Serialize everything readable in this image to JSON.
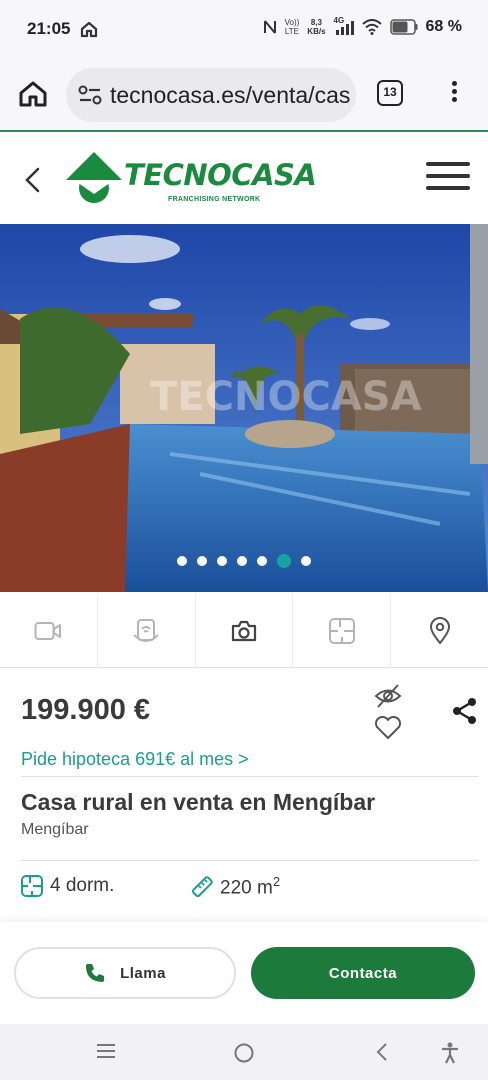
{
  "status_bar": {
    "time": "21:05",
    "network_speed_value": "8,3",
    "network_speed_unit": "KB/s",
    "volte_top": "Vo))",
    "volte_bottom": "LTE",
    "network_type": "4G",
    "battery_percent": "68 %",
    "icons": [
      "home-icon",
      "nfc-icon",
      "signal-icon",
      "wifi-icon",
      "battery-icon"
    ]
  },
  "browser": {
    "url": "tecnocasa.es/venta/casa-rural",
    "tab_count": "13"
  },
  "site_header": {
    "brand": "TECNOCASA",
    "tagline": "FRANCHISING NETWORK",
    "brand_color": "#1a8a3e"
  },
  "gallery": {
    "watermark": "TECNOCASA",
    "dot_count": 7,
    "active_index": 5,
    "active_color": "#19a2a2"
  },
  "toolbar": {
    "items": [
      "video-icon",
      "virtual-tour-icon",
      "photo-camera-icon",
      "floor-plan-icon",
      "map-pin-icon"
    ]
  },
  "listing": {
    "price": "199.900 €",
    "mortgage_link": "Pide hipoteca 691€ al mes >",
    "title": "Casa rural en venta en Mengíbar",
    "location": "Mengíbar",
    "bedrooms": "4 dorm.",
    "area": "220 m",
    "area_unit_sup": "2",
    "accent_color": "#1b9e8f"
  },
  "actions": {
    "call_label": "Llama",
    "contact_label": "Contacta",
    "contact_color": "#1c7a3d"
  }
}
